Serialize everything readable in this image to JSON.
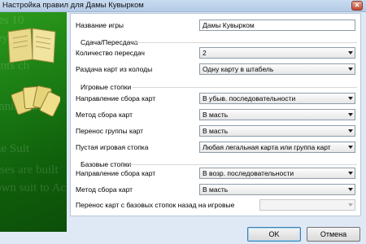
{
  "window": {
    "title": "Настройка правил для Дамы Кувырком"
  },
  "art": {
    "watermark": [
      "ies 10",
      "ey are b",
      "ents ch",
      "inning an",
      "ue Suit",
      "sses are built",
      "own suit to Ac"
    ]
  },
  "form": {
    "game_name": {
      "label": "Название игры",
      "value": "Дамы Кувырком"
    },
    "deal": {
      "title": "Сдача/Пересдача",
      "redeals": {
        "label": "Количество пересдач",
        "value": "2"
      },
      "deal_from_stock": {
        "label": "Раздача карт из колоды",
        "value": "Одну карту в штабель"
      }
    },
    "tableau": {
      "title": "Игровые стопки",
      "build_direction": {
        "label": "Направление сбора карт",
        "value": "В убыв. последовательности"
      },
      "build_method": {
        "label": "Метод сбора карт",
        "value": "В масть"
      },
      "group_move": {
        "label": "Перенос группы карт",
        "value": "В масть"
      },
      "empty_pile": {
        "label": "Пустая игровая стопка",
        "value": "Любая легальная карта или группа карт"
      }
    },
    "foundation": {
      "title": "Базовые стопки",
      "build_direction": {
        "label": "Направление сбора карт",
        "value": "В возр. последовательности"
      },
      "build_method": {
        "label": "Метод сбора карт",
        "value": "В масть"
      },
      "move_back": {
        "label": "Перенос карт с базовых стопок назад на игровые",
        "value": ""
      }
    }
  },
  "buttons": {
    "ok": "OK",
    "cancel": "Отмена"
  }
}
